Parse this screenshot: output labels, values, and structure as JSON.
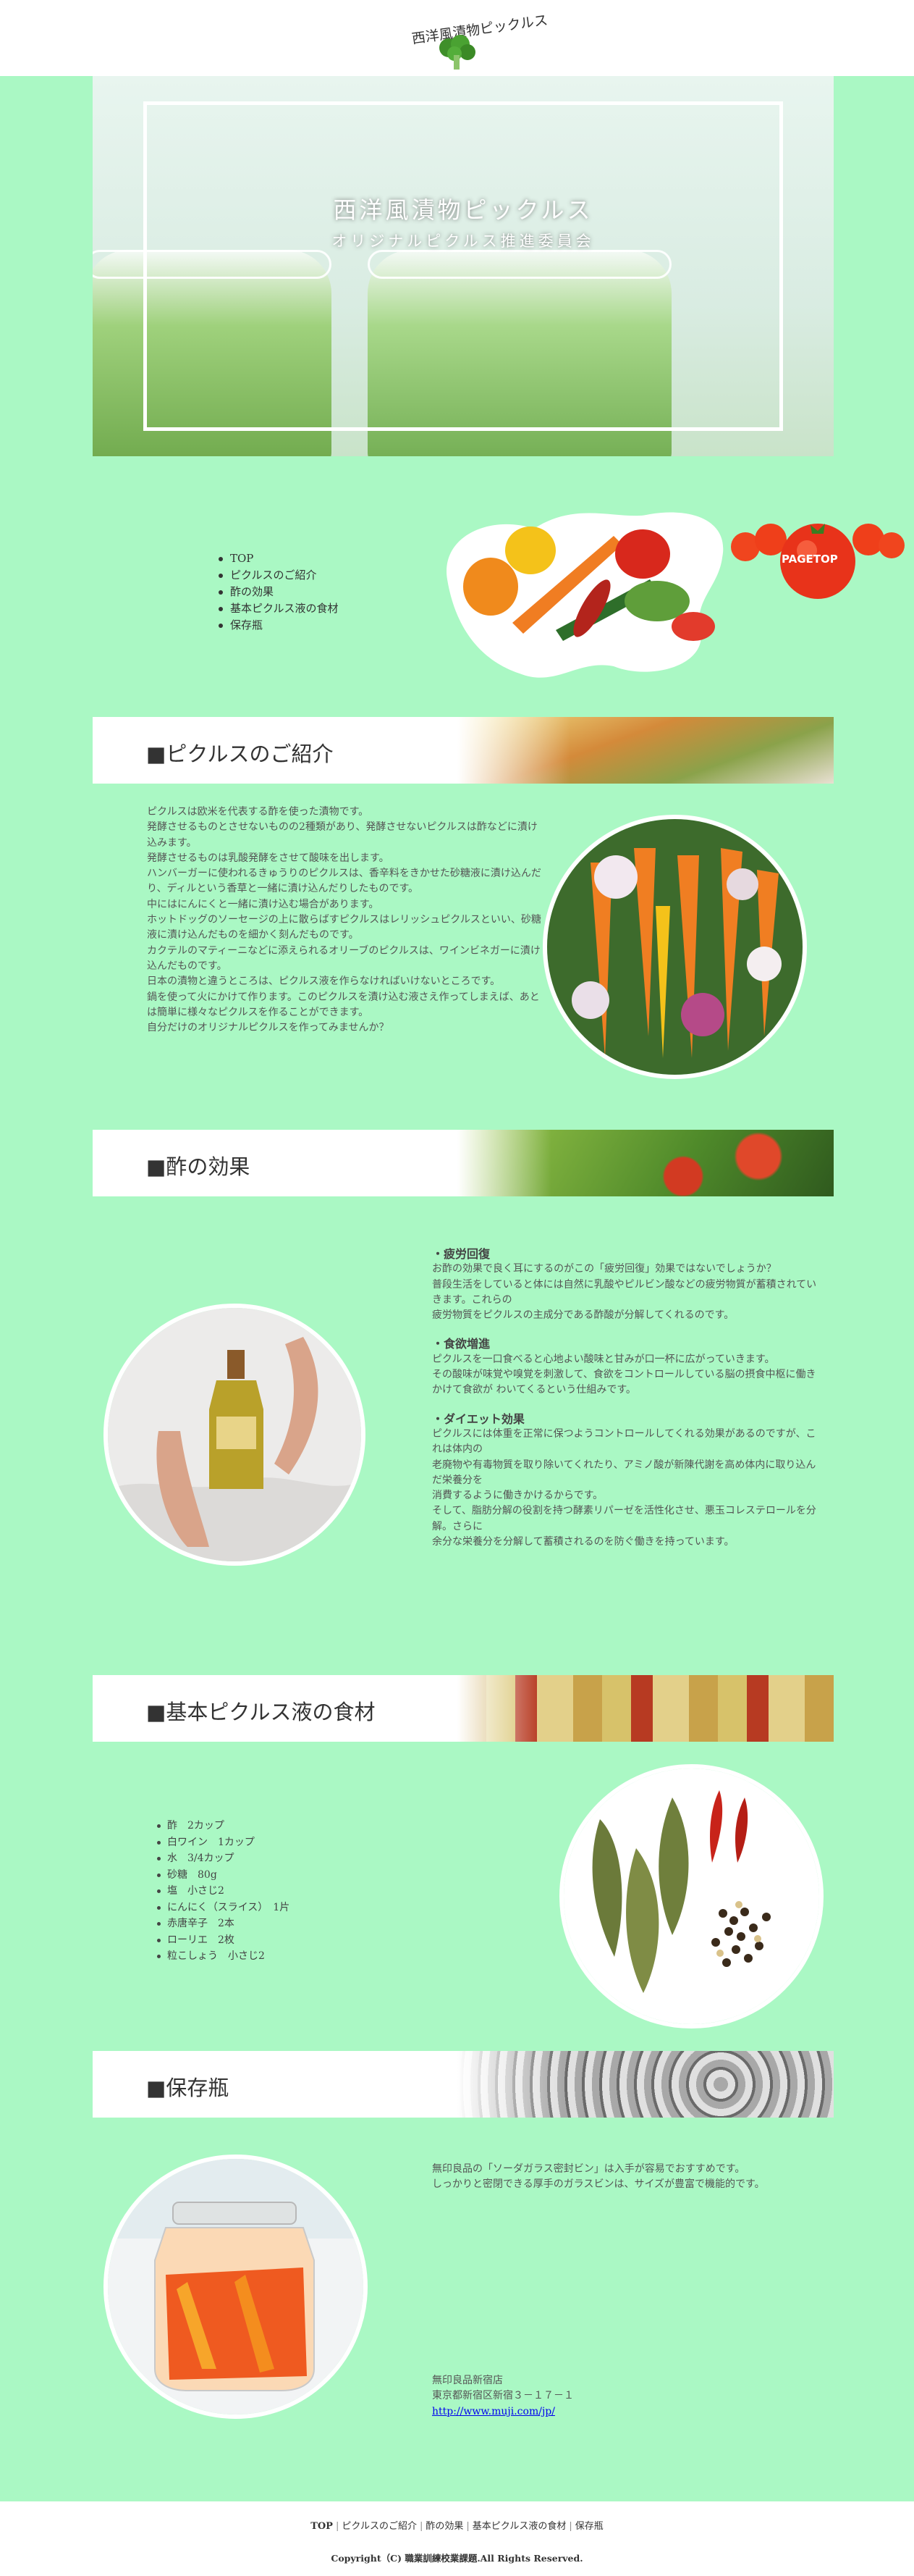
{
  "header": {
    "logo_text": "西洋風漬物ピックルス"
  },
  "hero": {
    "title": "西洋風漬物ピックルス",
    "subtitle": "オリジナルピクルス推進委員会"
  },
  "nav": {
    "items": [
      "TOP",
      "ピクルスのご紹介",
      "酢の効果",
      "基本ピクルス液の食材",
      "保存瓶"
    ]
  },
  "pagetop": {
    "label": "PAGETOP"
  },
  "sections": {
    "intro": {
      "title": "■ピクルスのご紹介",
      "paragraphs": [
        "ピクルスは欧米を代表する酢を使った漬物です。",
        "発酵させるものとさせないものの2種類があり、発酵させないピクルスは酢などに漬け込みます。",
        "発酵させるものは乳酸発酵をさせて酸味を出します。",
        "ハンバーガーに使われるきゅうりのピクルスは、香辛料をきかせた砂糖液に漬け込んだり、ディルという香草と一緒に漬け込んだりしたものです。",
        "中にはにんにくと一緒に漬け込む場合があります。",
        "ホットドッグのソーセージの上に散らばすピクルスはレリッシュピクルスといい、砂糖液に漬け込んだものを細かく刻んだものです。",
        "カクテルのマティーニなどに添えられるオリーブのピクルスは、ワインビネガーに漬け込んだものです。",
        "日本の漬物と違うところは、ピクルス液を作らなければいけないところです。",
        "鍋を使って火にかけて作ります。このピクルスを漬け込む液さえ作ってしまえば、あとは簡単に様々なピクルスを作ることができます。",
        "自分だけのオリジナルピクルスを作ってみませんか？"
      ]
    },
    "vinegar": {
      "title": "■酢の効果",
      "blocks": [
        {
          "heading": "・疲労回復",
          "lines": [
            "お酢の効果で良く耳にするのがこの「疲労回復」効果ではないでしょうか？",
            "普段生活をしていると体には自然に乳酸やピルビン酸などの疲労物質が蓄積されていきます。これらの",
            "疲労物質をピクルスの主成分である酢酸が分解してくれるのです。"
          ]
        },
        {
          "heading": "・食欲増進",
          "lines": [
            "ピクルスを一口食べると心地よい酸味と甘みが口一杯に広がっていきます。",
            "その酸味が味覚や嗅覚を刺激して、食欲をコントロールしている脳の摂食中枢に働きかけて食欲が わいてくるという仕組みです。"
          ]
        },
        {
          "heading": "・ダイエット効果",
          "lines": [
            "ピクルスには体重を正常に保つようコントロールしてくれる効果があるのですが、これは体内の",
            "老廃物や有毒物質を取り除いてくれたり、アミノ酸が新陳代謝を高め体内に取り込んだ栄養分を",
            "消費するように働きかけるからです。",
            "そして、脂肪分解の役割を持つ酵素リパーゼを活性化させ、悪玉コレステロールを分解。さらに",
            "余分な栄養分を分解して蓄積されるのを防ぐ働きを持っています。"
          ]
        }
      ]
    },
    "ingredients": {
      "title": "■基本ピクルス液の食材",
      "items": [
        "酢　2カップ",
        "白ワイン　1カップ",
        "水　3/4カップ",
        "砂糖　80g",
        "塩　小さじ2",
        "にんにく（スライス）　1片",
        "赤唐辛子　2本",
        "ローリエ　2枚",
        "粒こしょう　小さじ2"
      ]
    },
    "storage": {
      "title": "■保存瓶",
      "lines": [
        "無印良品の「ソーダガラス密封ビン」は入手が容易でおすすめです。",
        "しっかりと密閉できる厚手のガラスビンは、サイズが豊富で機能的です。"
      ],
      "shop_name": "無印良品新宿店",
      "address": "東京都新宿区新宿３－１７－１",
      "url": "http://www.muji.com/jp/"
    }
  },
  "footer": {
    "nav": [
      "TOP",
      "ピクルスのご紹介",
      "酢の効果",
      "基本ピクルス液の食材",
      "保存瓶"
    ],
    "copyright": "Copyright（C) 職業訓練校業課題.All Rights Reserved."
  },
  "colors": {
    "page_bg": "#aaf8c4",
    "white": "#ffffff",
    "text": "#555555"
  }
}
